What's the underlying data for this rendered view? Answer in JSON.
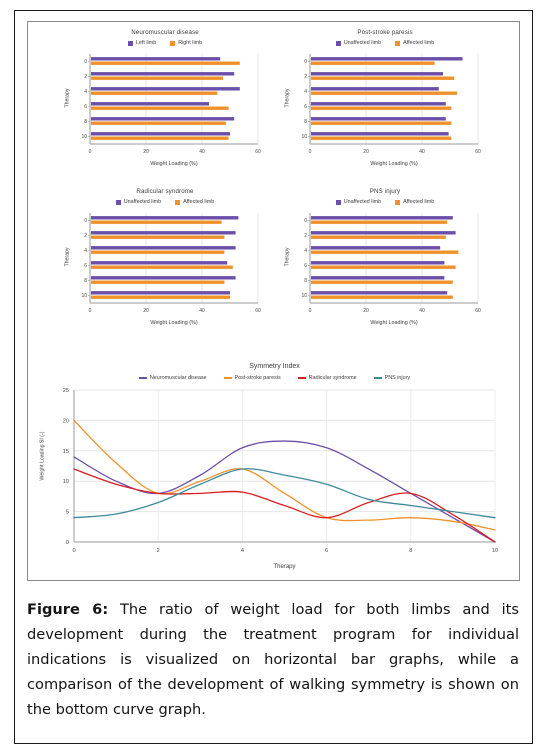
{
  "figure": {
    "caption_label": "Figure 6:",
    "caption_text": " The ratio of weight load for both limbs and its development during the treatment program for individual indications is visualized on horizontal bar graphs, while a comparison of the development of walking symmetry is shown on the bottom curve graph."
  },
  "colors": {
    "purple": "#6B4FA8",
    "orange": "#F0922B",
    "red": "#D81F20",
    "teal": "#3D8A9B",
    "grid": "#E3E3E3",
    "axis": "#9A9A9A",
    "text": "#3C3C3C"
  },
  "chart_data": [
    {
      "type": "bar",
      "orientation": "horizontal",
      "title": "Neuromuscular disease",
      "xlabel": "Weight Loading (%)",
      "ylabel": "Therapy",
      "categories": [
        "0",
        "2",
        "4",
        "6",
        "8",
        "10"
      ],
      "xlim": [
        0,
        60
      ],
      "xticks": [
        0,
        20,
        40,
        60
      ],
      "grid": true,
      "legend_position": "top",
      "series": [
        {
          "name": "Left limb",
          "color": "#6B4FA8",
          "values": [
            46.5,
            51.5,
            53.5,
            42.5,
            51.5,
            50.0
          ]
        },
        {
          "name": "Right limb",
          "color": "#F0922B",
          "values": [
            53.5,
            47.5,
            45.5,
            49.5,
            48.5,
            49.5
          ]
        }
      ]
    },
    {
      "type": "bar",
      "orientation": "horizontal",
      "title": "Post-stroke paresis",
      "xlabel": "Weight Loading (%)",
      "ylabel": "Therapy",
      "categories": [
        "0",
        "2",
        "4",
        "6",
        "8",
        "10"
      ],
      "xlim": [
        0,
        60
      ],
      "xticks": [
        0,
        20,
        40,
        60
      ],
      "grid": true,
      "legend_position": "top",
      "series": [
        {
          "name": "Unaffected limb",
          "color": "#6B4FA8",
          "values": [
            54.5,
            47.5,
            46.0,
            48.5,
            48.5,
            49.5
          ]
        },
        {
          "name": "Affected limb",
          "color": "#F0922B",
          "values": [
            44.5,
            51.5,
            52.5,
            50.5,
            50.5,
            50.5
          ]
        }
      ]
    },
    {
      "type": "bar",
      "orientation": "horizontal",
      "title": "Radicular syndrome",
      "xlabel": "Weight Loading (%)",
      "ylabel": "Therapy",
      "categories": [
        "0",
        "2",
        "4",
        "6",
        "8",
        "10"
      ],
      "xlim": [
        0,
        60
      ],
      "xticks": [
        0,
        20,
        40,
        60
      ],
      "grid": true,
      "legend_position": "top",
      "series": [
        {
          "name": "Unaffected limb",
          "color": "#6B4FA8",
          "values": [
            53.0,
            52.0,
            52.0,
            49.0,
            52.0,
            50.0
          ]
        },
        {
          "name": "Affected limb",
          "color": "#F0922B",
          "values": [
            47.0,
            48.0,
            48.0,
            51.0,
            48.0,
            50.0
          ]
        }
      ]
    },
    {
      "type": "bar",
      "orientation": "horizontal",
      "title": "PNS injury",
      "xlabel": "Weight Loading (%)",
      "ylabel": "Therapy",
      "categories": [
        "0",
        "2",
        "4",
        "6",
        "8",
        "10"
      ],
      "xlim": [
        0,
        60
      ],
      "xticks": [
        0,
        20,
        40,
        60
      ],
      "grid": true,
      "legend_position": "top",
      "series": [
        {
          "name": "Unaffected limb",
          "color": "#6B4FA8",
          "values": [
            51.0,
            52.0,
            46.5,
            48.0,
            48.0,
            49.0
          ]
        },
        {
          "name": "Affected limb",
          "color": "#F0922B",
          "values": [
            49.0,
            48.5,
            53.0,
            52.0,
            51.0,
            51.0
          ]
        }
      ]
    },
    {
      "type": "line",
      "title": "Symmetry Index",
      "xlabel": "Therapy",
      "ylabel": "Weight Loading SI (-)",
      "x": [
        0,
        1,
        2,
        3,
        4,
        5,
        6,
        7,
        8,
        9,
        10
      ],
      "xlim": [
        0,
        10
      ],
      "ylim": [
        0,
        25
      ],
      "xticks": [
        0,
        2,
        4,
        6,
        8,
        10
      ],
      "yticks": [
        0,
        5,
        10,
        15,
        20,
        25
      ],
      "grid": true,
      "legend_position": "top",
      "smooth": true,
      "series": [
        {
          "name": "Neuromuscular disease",
          "color": "#6B4FA8",
          "values": [
            14,
            10,
            8,
            11,
            15.5,
            16.6,
            15.5,
            12,
            8,
            4,
            0
          ]
        },
        {
          "name": "Post-stroke paresis",
          "color": "#F0922B",
          "values": [
            20,
            13,
            8,
            10,
            12,
            8,
            4,
            3.6,
            4,
            3.4,
            2
          ]
        },
        {
          "name": "Radicular syndrome",
          "color": "#D81F20",
          "values": [
            12,
            9.5,
            8,
            8,
            8.2,
            6,
            4,
            6.5,
            8,
            4.5,
            0
          ]
        },
        {
          "name": "PNS injury",
          "color": "#3D8A9B",
          "values": [
            4,
            4.6,
            6.5,
            9.5,
            12,
            11,
            9.5,
            7,
            6,
            5,
            4
          ]
        }
      ]
    }
  ]
}
